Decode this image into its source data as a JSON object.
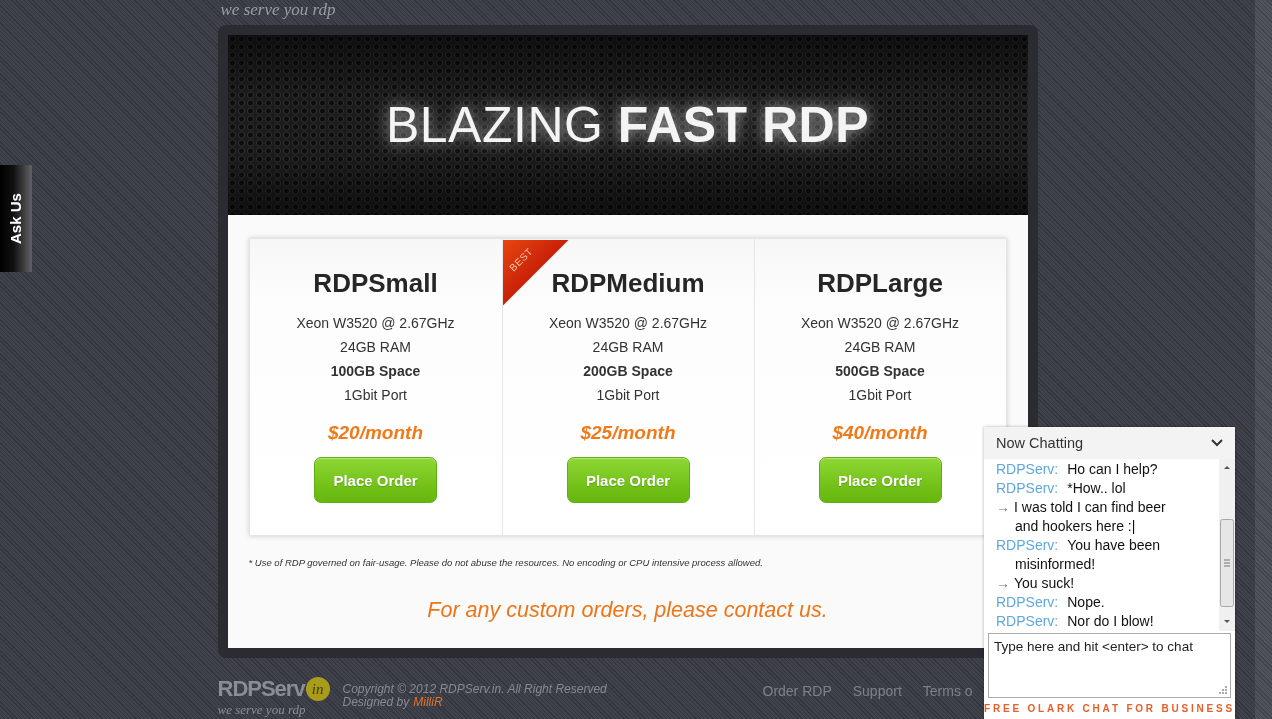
{
  "header": {
    "tagline": "we serve you rdp"
  },
  "ask_us_tab": {
    "label": "Ask Us"
  },
  "banner": {
    "title": "BLAZING **FAST RDP**"
  },
  "plans": [
    {
      "name": "RDPSmall",
      "specs": [
        {
          "text": "Xeon W3520 @ 2.67GHz",
          "emphasized": false
        },
        {
          "text": "24GB RAM",
          "emphasized": false
        },
        {
          "text": "100GB Space",
          "emphasized": true
        },
        {
          "text": "1Gbit Port",
          "emphasized": false
        }
      ],
      "price": "$20/month",
      "button": "Place Order"
    },
    {
      "name": "RDPMedium",
      "ribbon": "BEST",
      "specs": [
        {
          "text": "Xeon W3520 @ 2.67GHz",
          "emphasized": false
        },
        {
          "text": "24GB RAM",
          "emphasized": false
        },
        {
          "text": "200GB Space",
          "emphasized": true
        },
        {
          "text": "1Gbit Port",
          "emphasized": false
        }
      ],
      "price": "$25/month",
      "button": "Place Order"
    },
    {
      "name": "RDPLarge",
      "specs": [
        {
          "text": "Xeon W3520 @ 2.67GHz",
          "emphasized": false
        },
        {
          "text": "24GB RAM",
          "emphasized": false
        },
        {
          "text": "500GB Space",
          "emphasized": true
        },
        {
          "text": "1Gbit Port",
          "emphasized": false
        }
      ],
      "price": "$40/month",
      "button": "Place Order"
    }
  ],
  "footnote": "* Use of RDP governed on fair-usage. Please do not abuse the resources. No encoding or CPU intensive process allowed.",
  "contact": "For any custom orders, please contact us.",
  "footer": {
    "logo": {
      "wordmark": "RDPServ",
      "badge": "in",
      "tagline": "we serve you rdp"
    },
    "copyright": "Copyright © 2012 RDPServ.in. All Right Reserved",
    "credit": {
      "label": "Designed by",
      "link": "MilliR"
    },
    "nav": [
      "Order RDP",
      "Support",
      "Terms o"
    ]
  },
  "chat": {
    "title": "Now Chatting",
    "messages": [
      {
        "kind": "operator",
        "sender": "RDPServ:",
        "text": "Ho can I help?"
      },
      {
        "kind": "operator",
        "sender": "RDPServ:",
        "text": "*How.. lol"
      },
      {
        "kind": "visitor",
        "marker": "→",
        "text": "I was told I can find beer and hookers here :|"
      },
      {
        "kind": "operator",
        "sender": "RDPServ:",
        "text": "You have been misinformed!"
      },
      {
        "kind": "visitor",
        "marker": "→",
        "text": "You suck!"
      },
      {
        "kind": "operator",
        "sender": "RDPServ:",
        "text": "Nope."
      },
      {
        "kind": "operator",
        "sender": "RDPServ:",
        "text": "Nor do I blow!"
      }
    ],
    "input": {
      "placeholder": "Type here and hit <enter> to chat"
    },
    "promo": "FREE OLARK CHAT FOR BUSINESS"
  }
}
